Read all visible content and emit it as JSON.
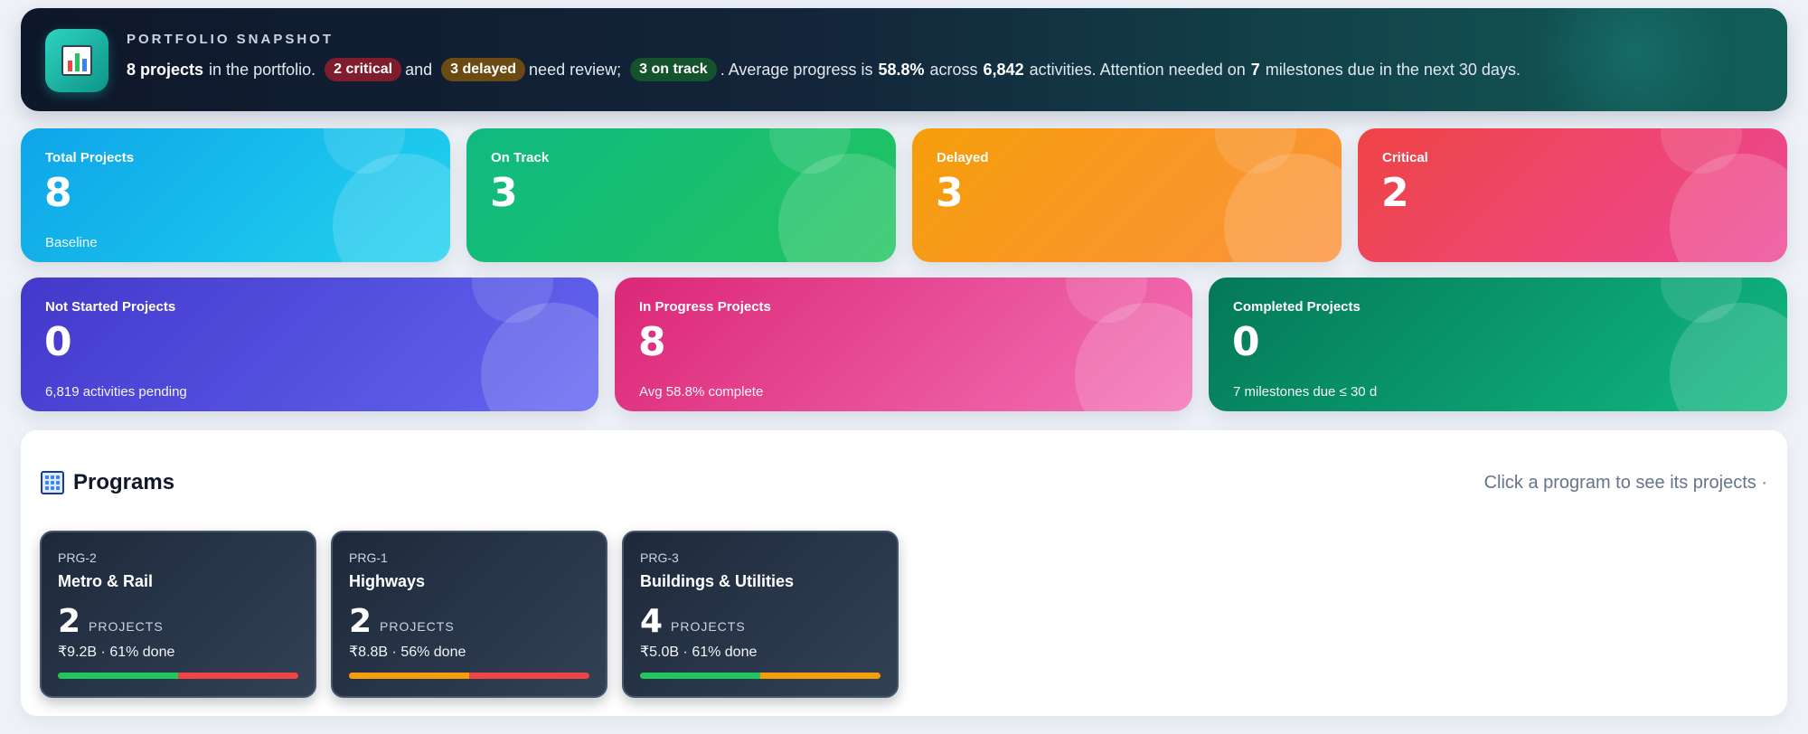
{
  "banner": {
    "kicker": "PORTFOLIO SNAPSHOT",
    "icon": "bar-chart-icon",
    "projects_count": "8 projects",
    "t1": "in the portfolio.",
    "critical_pill": "2 critical",
    "t2": "and",
    "delayed_pill": "3 delayed",
    "t3": "need review;",
    "ontrack_pill": "3 on track",
    "t4": ". Average progress is",
    "avg_progress": "58.8%",
    "t5": "across",
    "activities": "6,842",
    "t6": "activities. Attention needed on",
    "milestones": "7",
    "t7": "milestones due in the next 30 days."
  },
  "stats": {
    "total": {
      "label": "Total Projects",
      "value": "8",
      "sub": "Baseline"
    },
    "on_track": {
      "label": "On Track",
      "value": "3",
      "sub": ""
    },
    "delayed": {
      "label": "Delayed",
      "value": "3",
      "sub": ""
    },
    "critical": {
      "label": "Critical",
      "value": "2",
      "sub": ""
    },
    "not_started": {
      "label": "Not Started Projects",
      "value": "0",
      "sub": "6,819 activities pending"
    },
    "in_progress": {
      "label": "In Progress Projects",
      "value": "8",
      "sub": "Avg 58.8% complete"
    },
    "completed": {
      "label": "Completed Projects",
      "value": "0",
      "sub": "7 milestones due ≤ 30 d"
    }
  },
  "programs": {
    "icon": "building-icon",
    "title": "Programs",
    "hint": "Click a program to see its projects ·",
    "items": [
      {
        "code": "PRG-2",
        "name": "Metro & Rail",
        "count": "2",
        "unit": "PROJECTS",
        "meta": "₹9.2B · 61% done",
        "segments": [
          {
            "color": "#22c55e",
            "fraction": 0.5
          },
          {
            "color": "#ef4444",
            "fraction": 0.5
          }
        ]
      },
      {
        "code": "PRG-1",
        "name": "Highways",
        "count": "2",
        "unit": "PROJECTS",
        "meta": "₹8.8B · 56% done",
        "segments": [
          {
            "color": "#f59e0b",
            "fraction": 0.5
          },
          {
            "color": "#ef4444",
            "fraction": 0.5
          }
        ]
      },
      {
        "code": "PRG-3",
        "name": "Buildings & Utilities",
        "count": "4",
        "unit": "PROJECTS",
        "meta": "₹5.0B · 61% done",
        "segments": [
          {
            "color": "#22c55e",
            "fraction": 0.5
          },
          {
            "color": "#f59e0b",
            "fraction": 0.5
          }
        ]
      }
    ]
  }
}
